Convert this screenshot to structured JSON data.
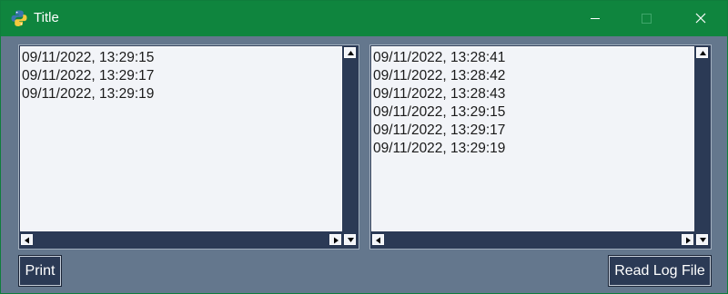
{
  "window": {
    "title": "Title"
  },
  "left_list": {
    "items": [
      "09/11/2022, 13:29:15",
      "09/11/2022, 13:29:17",
      "09/11/2022, 13:29:19"
    ]
  },
  "right_list": {
    "items": [
      "09/11/2022, 13:28:41",
      "09/11/2022, 13:28:42",
      "09/11/2022, 13:28:43",
      "09/11/2022, 13:29:15",
      "09/11/2022, 13:29:17",
      "09/11/2022, 13:29:19"
    ]
  },
  "buttons": {
    "print_label": "Print",
    "read_log_label": "Read Log File"
  },
  "icons": {
    "app": "python-icon",
    "minimize": "minimize-icon",
    "maximize": "maximize-icon",
    "close": "close-icon"
  },
  "colors": {
    "titlebar": "#0f853e",
    "window_bg": "#64778d",
    "list_bg": "#f2f4f8",
    "accent": "#2b3a55"
  }
}
